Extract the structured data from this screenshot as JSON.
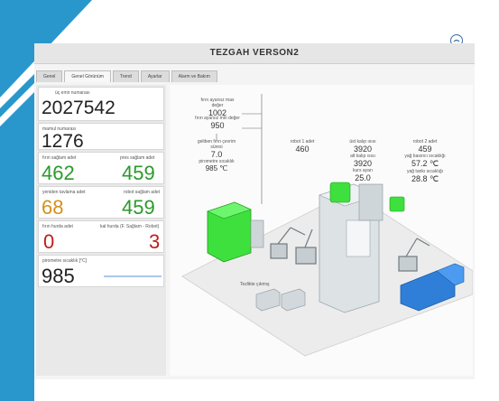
{
  "window": {
    "title": "TEZGAH VERSON2"
  },
  "tabs": [
    "Genel",
    "Genel Görünüm",
    "Trend",
    "Ayarlar",
    "Alarm ve Bakım"
  ],
  "cards": {
    "total": {
      "label": "üç emir numarası",
      "value": "2027542"
    },
    "mold": {
      "label": "mamul numarası",
      "value": "1276"
    },
    "oven_in": {
      "label": "fırın sağlam adet",
      "value": "462"
    },
    "oven_pass": {
      "label": "pres sağlam adet",
      "value": "459"
    },
    "reject": {
      "label": "yeniden tavlama adet",
      "value": "68"
    },
    "robot_ok": {
      "label": "robot sağlam adet",
      "value": "459"
    },
    "oven_scrap": {
      "label": "fırın hurda adet",
      "value": "0"
    },
    "cast_scrap": {
      "label": "kal hurda (F. Sağlam - Robot)",
      "value": "3"
    },
    "pyro": {
      "label": "pirometre sıcaklık [°C]",
      "value": "985"
    }
  },
  "annotations": {
    "oven_max": {
      "label": "fırın ayarsız max değer",
      "value": "1002"
    },
    "oven_min": {
      "label": "fırın ayarsız min değer",
      "value": "950"
    },
    "oven_time": {
      "label": "geliben fırın çevrim süresi",
      "value": "7.0"
    },
    "pyro_temp": {
      "label": "pirometre sıcaklık",
      "value": "985 ℃"
    },
    "robot1": {
      "label": "robot 1 adet",
      "value": "460"
    },
    "top_kalip": {
      "label": "üst kalıp ısısı",
      "value": "3920"
    },
    "alt_kalip": {
      "label": "alt kalıp ısısı",
      "value": "3920"
    },
    "kurs": {
      "label": "kurs ayarı",
      "value": "25.0"
    },
    "robot2": {
      "label": "robot 2 adet",
      "value": "459"
    },
    "yag_basinc": {
      "label": "yağ basıncı sıcaklığı",
      "value": "57.2 ℃"
    },
    "yag_tank": {
      "label": "yağ tankı sıcaklığı",
      "value": "28.8 ℃"
    },
    "scrap_area": {
      "label": "Tezlikte çıkmış"
    }
  },
  "colors": {
    "accent_bar": "#2a97cc",
    "green": "#2a9a2a",
    "orange": "#d4901b",
    "red": "#c31b1b",
    "machine_green": "#3ee03e",
    "machine_blue": "#2f7fd8"
  }
}
